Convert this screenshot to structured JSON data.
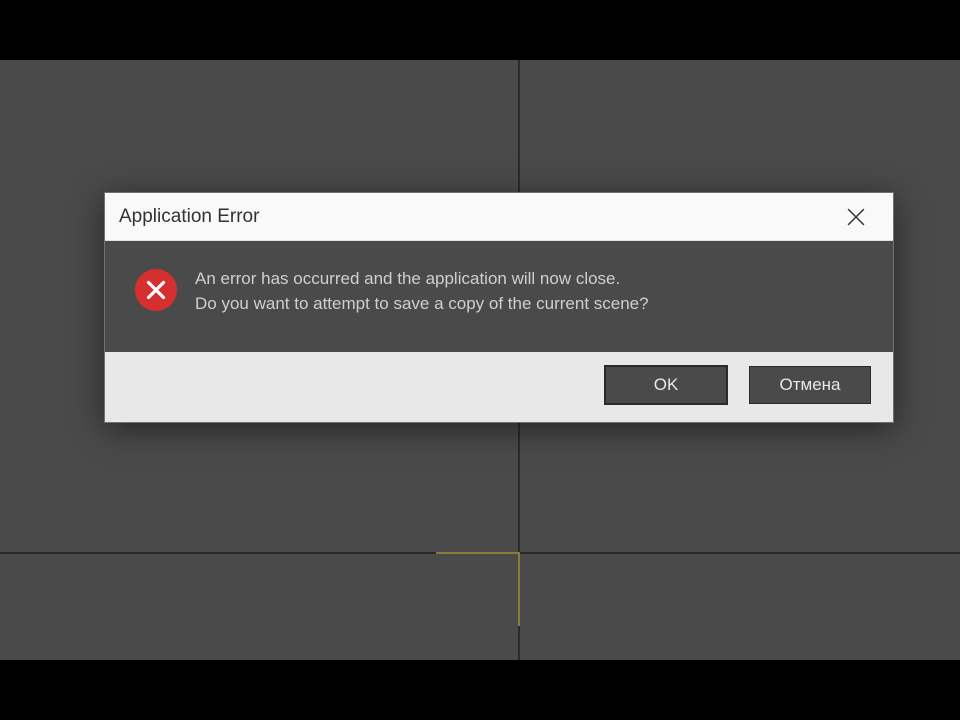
{
  "dialog": {
    "title": "Application Error",
    "message_line1": "An error has occurred and the application will now close.",
    "message_line2": "Do you want to attempt to save a copy of the current scene?",
    "ok_label": "OK",
    "cancel_label": "Отмена"
  }
}
